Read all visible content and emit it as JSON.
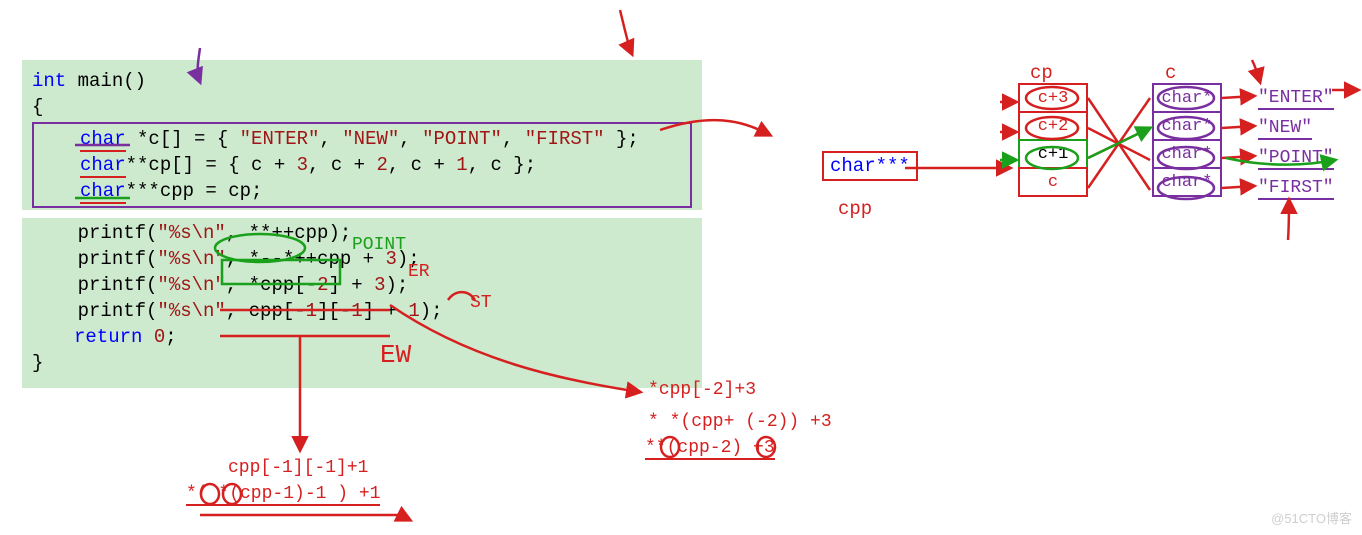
{
  "code": {
    "l1a": "int",
    "l1b": " main()",
    "l2": "{",
    "l3a": "char",
    "l3b": " *c[] = { ",
    "l3s1": "\"ENTER\"",
    "l3c": ", ",
    "l3s2": "\"NEW\"",
    "l3s3": "\"POINT\"",
    "l3s4": "\"FIRST\"",
    "l3d": " };",
    "l4a": "char",
    "l4b": "**cp[] = { c + ",
    "l4n1": "3",
    "l4c": ", c + ",
    "l4n2": "2",
    "l4n3": "1",
    "l4d": ", c };",
    "l5a": "char",
    "l5b": "***cpp = cp;",
    "l6a": "    printf(",
    "l6f": "\"%s\\n\"",
    "l6b": ", **++cpp);",
    "l7a": "    printf(",
    "l7f": "\"%s\\n\"",
    "l7b": ", *--*++cpp + ",
    "l7n": "3",
    "l7c": ");",
    "l8a": "    printf(",
    "l8f": "\"%s\\n\"",
    "l8b": ", *cpp[-",
    "l8n1": "2",
    "l8c": "] + ",
    "l8n2": "3",
    "l8d": ");",
    "l9a": "    printf(",
    "l9f": "\"%s\\n\"",
    "l9b": ", cpp[-",
    "l9n1": "1",
    "l9c": "][-",
    "l9n2": "1",
    "l9d": "] + ",
    "l9n3": "1",
    "l9e": ");",
    "l10a": "return",
    "l10b": " ",
    "l10n": "0",
    "l10c": ";",
    "l11": "}"
  },
  "ann": {
    "point": "POINT",
    "er": "ER",
    "st": "ST",
    "ew": "EW",
    "cppm2_1": "*cpp[-2]+3",
    "cppm2_2": "* *(cpp+ (-2)) +3",
    "cppm2_3": "**(cpp-2) +3",
    "cppm1_1": "cpp[-1][-1]+1",
    "cppm1_2": "*(  *(cpp-1)-1   ) +1"
  },
  "right": {
    "cpp_box": "char***",
    "cpp_label": "cpp",
    "cp_label": "cp",
    "c_label": "c",
    "cp": [
      "c+3",
      "c+2",
      "c+1",
      "c"
    ],
    "c": [
      "char*",
      "char*",
      "char*",
      "char*"
    ],
    "vals": [
      "\"ENTER\"",
      "\"NEW\"",
      "\"POINT\"",
      "\"FIRST\""
    ]
  },
  "watermark": "@51CTO博客"
}
